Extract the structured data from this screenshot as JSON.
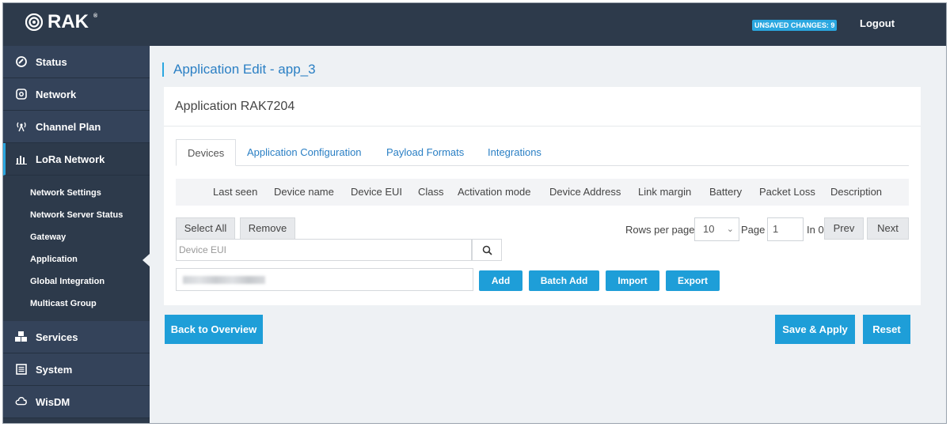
{
  "header": {
    "brand": "RAK",
    "brand_mark": "®",
    "unsaved_badge": "UNSAVED CHANGES: 9",
    "logout": "Logout"
  },
  "sidebar": {
    "items": [
      {
        "label": "Status",
        "icon": "status-icon"
      },
      {
        "label": "Network",
        "icon": "network-icon"
      },
      {
        "label": "Channel Plan",
        "icon": "antenna-icon"
      },
      {
        "label": "LoRa Network",
        "icon": "bars-icon"
      }
    ],
    "sub_items": [
      {
        "label": "Network Settings"
      },
      {
        "label": "Network Server Status"
      },
      {
        "label": "Gateway"
      },
      {
        "label": "Application"
      },
      {
        "label": "Global Integration"
      },
      {
        "label": "Multicast Group"
      }
    ],
    "bottom_items": [
      {
        "label": "Services",
        "icon": "services-icon"
      },
      {
        "label": "System",
        "icon": "system-icon"
      },
      {
        "label": "WisDM",
        "icon": "cloud-icon"
      }
    ]
  },
  "main": {
    "page_title": "Application Edit - app_3",
    "card_title": "Application RAK7204",
    "tabs": [
      {
        "label": "Devices"
      },
      {
        "label": "Application Configuration"
      },
      {
        "label": "Payload Formats"
      },
      {
        "label": "Integrations"
      }
    ],
    "columns": [
      "Last seen",
      "Device name",
      "Device EUI",
      "Class",
      "Activation mode",
      "Device Address",
      "Link margin",
      "Battery",
      "Packet Loss",
      "Description"
    ],
    "select_all": "Select All",
    "remove": "Remove",
    "rows_per_page_label": "Rows per page",
    "rows_per_page_value": "10",
    "page_label": "Page",
    "page_value": "1",
    "in_label": "In 0",
    "prev": "Prev",
    "next": "Next",
    "search_placeholder": "Device EUI",
    "add": "Add",
    "batch_add": "Batch Add",
    "import": "Import",
    "export": "Export"
  },
  "footer_actions": {
    "back": "Back to Overview",
    "save": "Save & Apply",
    "reset": "Reset"
  },
  "colors": {
    "sidebar_bg": "#2d3a4b",
    "accent": "#1e9ed8",
    "link": "#2a7fc4"
  }
}
